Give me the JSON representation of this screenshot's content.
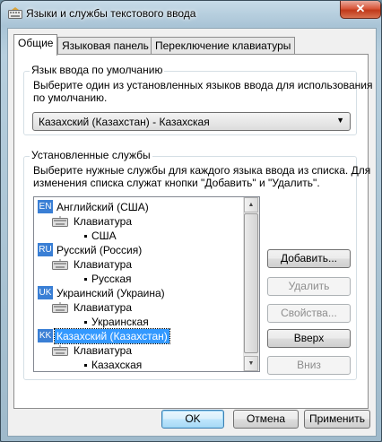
{
  "window": {
    "title": "Языки и службы текстового ввода",
    "close_glyph": "✕"
  },
  "tabs": [
    {
      "label": "Общие",
      "active": true
    },
    {
      "label": "Языковая панель",
      "active": false
    },
    {
      "label": "Переключение клавиатуры",
      "active": false
    }
  ],
  "default_language": {
    "group_title": "Язык ввода по умолчанию",
    "description_line1": "Выберите один из установленных языков ввода для использования",
    "description_line2": "по умолчанию.",
    "selected_value": "Казахский (Казахстан) - Казахская",
    "arrow": "▼"
  },
  "installed_services": {
    "group_title": "Установленные службы",
    "description_line1": "Выберите нужные службы для каждого языка ввода из списка. Для",
    "description_line2": "изменения списка служат кнопки \"Добавить\" и \"Удалить\".",
    "tree": [
      {
        "badge": "EN",
        "language": "Английский (США)",
        "category": "Клавиатура",
        "layout": "США",
        "selected": false
      },
      {
        "badge": "RU",
        "language": "Русский (Россия)",
        "category": "Клавиатура",
        "layout": "Русская",
        "selected": false
      },
      {
        "badge": "UK",
        "language": "Украинский (Украина)",
        "category": "Клавиатура",
        "layout": "Украинская",
        "selected": false
      },
      {
        "badge": "KK",
        "language": "Казахский (Казахстан)",
        "category": "Клавиатура",
        "layout": "Казахская",
        "selected": true
      }
    ],
    "buttons": {
      "add": "Добавить...",
      "remove": "Удалить",
      "properties": "Свойства...",
      "up": "Вверх",
      "down": "Вниз"
    },
    "scroll_up": "▲",
    "scroll_down": "▼"
  },
  "footer": {
    "ok": "OK",
    "cancel": "Отмена",
    "apply": "Применить"
  },
  "colors": {
    "badge": "#3a7fd5",
    "selection": "#3399ff",
    "close_button": "#c0391a"
  }
}
